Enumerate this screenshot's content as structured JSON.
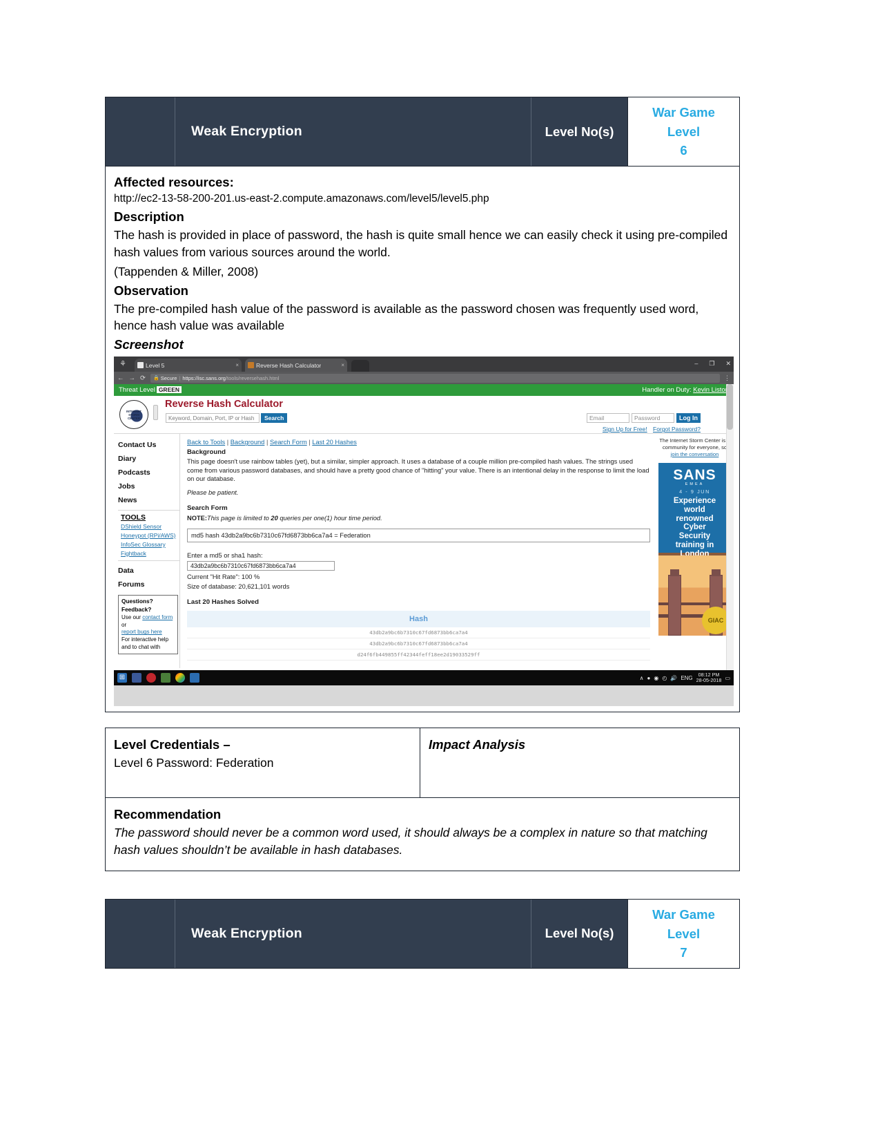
{
  "report": {
    "header": {
      "title": "Weak Encryption",
      "level_label": "Level No(s)",
      "wargame_line1": "War Game",
      "wargame_line2": "Level",
      "wargame_line3": "6",
      "accent_color": "#29abe2",
      "header_bg": "#323e4f"
    },
    "affected_resources_heading": "Affected resources:",
    "affected_resources_url": "http://ec2-13-58-200-201.us-east-2.compute.amazonaws.com/level5/level5.php",
    "description_heading": "Description",
    "description_text": "The hash is provided in place of password, the hash is quite small hence we can easily check it using pre-compiled hash values from various sources around the world.",
    "description_citation": "(Tappenden & Miller, 2008)",
    "observation_heading": "Observation",
    "observation_text": "The pre-compiled hash value of the password is available as the password chosen was frequently used word, hence hash value was available",
    "screenshot_heading": "Screenshot",
    "credentials_heading": "Level Credentials –",
    "credentials_value": "Level 6 Password: Federation",
    "impact_heading": "Impact Analysis",
    "recommendation_heading": "Recommendation",
    "recommendation_text": "The password should never be a common word used, it should always be a complex in nature so that matching hash values shouldn’t be available in hash databases.",
    "next_header": {
      "title": "Weak Encryption",
      "level_label": "Level No(s)",
      "wargame_line1": "War Game",
      "wargame_line2": "Level",
      "wargame_line3": "7"
    }
  },
  "browser": {
    "tabs": [
      {
        "label": "Level 5",
        "close": "×",
        "active": false
      },
      {
        "label": "Reverse Hash Calculator",
        "close": "×",
        "active": true
      }
    ],
    "window_buttons": {
      "minimize": "–",
      "maximize": "❐",
      "close": "✕"
    },
    "nav": {
      "back": "←",
      "forward": "→",
      "reload": "⟳",
      "menu": "⋮"
    },
    "omnibox": {
      "lock": "🔒",
      "secure_label": "Secure",
      "separator": "|",
      "url_scheme_host": "https://isc.sans.org",
      "url_path": "/tools/reversehash.html"
    }
  },
  "isc": {
    "threat_level_label": "Threat Level",
    "threat_level_value": "GREEN",
    "handler_prefix": "Handler on Duty:",
    "handler_name": "Kevin Liston",
    "logo_text": "INTERNET STORM CENTER",
    "page_title": "Reverse Hash Calculator",
    "search_placeholder": "Keyword, Domain, Port, IP or Hash",
    "search_button": "Search",
    "login": {
      "email_placeholder": "Email",
      "password_placeholder": "Password",
      "login_button": "Log In",
      "signup_link": "Sign Up for Free!",
      "forgot_link": "Forgot Password?"
    },
    "sidebar": {
      "items": [
        "Contact Us",
        "Diary",
        "Podcasts",
        "Jobs",
        "News"
      ],
      "tools_title": "TOOLS",
      "tools_links": [
        "DShield Sensor",
        "Honeypot (RPi/AWS)",
        "InfoSec Glossary",
        "Fightback"
      ],
      "data_label": "Data",
      "forums_label": "Forums",
      "questions_box": {
        "line1": "Questions?",
        "line2": "Feedback?",
        "line3_pre": "Use our ",
        "line3_link": "contact form",
        "line3_post": " or",
        "line4_link": "report bugs here",
        "line5": "For interactive help",
        "line6": "and to chat with"
      }
    },
    "main": {
      "top_links": [
        "Back to Tools",
        "Background",
        "Search Form",
        "Last 20 Hashes"
      ],
      "top_links_separator": "|",
      "background_heading": "Background",
      "background_p1": "This page doesn't use rainbow tables (yet), but a similar, simpler approach. It uses a database of a couple million pre-compiled hash values. The strings used come from various password databases, and should have a pretty good chance of \"hitting\" your value. There is an intentional delay in the response to limit the load on our database.",
      "patient_note": "Please be patient.",
      "search_form_heading": "Search Form",
      "note_label": "NOTE:",
      "note_text_1": "This page is limited to ",
      "note_bold": "20",
      "note_text_2": " queries per one(1) hour time period.",
      "result_box_value": "md5 hash 43db2a9bc6b7310c67fd6873bb6ca7a4 = Federation",
      "input_label": "Enter a md5 or sha1 hash:",
      "input_value": "43db2a9bc6b7310c67fd6873bb6ca7a4",
      "hit_rate": "Current \"Hit Rate\": 100 %",
      "db_size": "Size of database: 20,621,101 words",
      "last20_heading": "Last 20 Hashes Solved",
      "table_header": "Hash",
      "table_rows": [
        "43db2a9bc6b7310c67fd6873bb6ca7a4",
        "43db2a9bc6b7310c67fd6873bb6ca7a4",
        "d24f6fb449855ff42344feff18ee2d19033529ff"
      ]
    },
    "right": {
      "blurb_pre": "The Internet Storm Center is a community for everyone, so ",
      "blurb_link": "join the conversation",
      "ad": {
        "brand": "SANS",
        "brand_sub": "EMEA",
        "dates": "4 - 9 JUN",
        "lines": [
          "Experience",
          "world",
          "renowned",
          "Cyber",
          "Security",
          "training in",
          "London"
        ],
        "badge": "GIAC"
      }
    }
  },
  "taskbar": {
    "start": "⊞",
    "language": "ENG",
    "time": "08:12 PM",
    "date": "28-05-2018",
    "tray_icons": [
      "∧",
      "●",
      "◉",
      "◴",
      "🔊"
    ],
    "notification": "▭"
  }
}
